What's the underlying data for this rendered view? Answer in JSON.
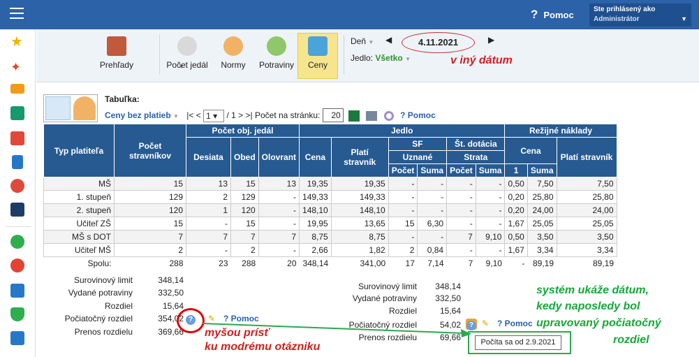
{
  "topbar": {
    "help_label": "Pomoc",
    "user_line1": "Ste prihlásený ako",
    "user_line2": "Administrátor"
  },
  "sidebar": {
    "icons": [
      "star-icon",
      "magic-icon",
      "mail-icon",
      "home-icon",
      "calendar-grid-icon",
      "tablet-icon",
      "person-icon",
      "calendar-icon",
      "check-icon",
      "pdf-icon",
      "briefcase-icon",
      "shield-icon",
      "chart-icon"
    ]
  },
  "toolbar": {
    "prehlady": "Prehľady",
    "pocet_jedal": "Počet jedál",
    "normy": "Normy",
    "potraviny": "Potraviny",
    "ceny": "Ceny",
    "den_label": "Deň",
    "date": "4.11.2021",
    "jedlo_label": "Jedlo:",
    "jedlo_value": "Všetko"
  },
  "annotations": {
    "date_note": "v iný dátum",
    "mouse_note_1": "myšou prísť",
    "mouse_note_2": "ku modrému otázniku",
    "system_note_1": "systém ukáže dátum,",
    "system_note_2": "kedy naposledy bol",
    "system_note_3": "upravovaný počiatočný",
    "system_note_4": "rozdiel"
  },
  "tabulka": {
    "label": "Tabuľka:",
    "selected": "Ceny bez platieb",
    "page_current": "1",
    "page_total": "/ 1",
    "per_page_label": "Počet na stránku:",
    "per_page_value": "20",
    "help": "Pomoc"
  },
  "table": {
    "h_typ": "Typ platiteľa",
    "h_pocet_strav": "Počet stravníkov",
    "h_pocet_obj": "Počet obj. jedál",
    "h_jedlo": "Jedlo",
    "h_rezijne": "Režijné náklady",
    "h_desiata": "Desiata",
    "h_obed": "Obed",
    "h_olovrant": "Olovrant",
    "h_cena": "Cena",
    "h_plati": "Platí stravník",
    "h_sf": "SF",
    "h_st_dotacia": "Št. dotácia",
    "h_uznane": "Uznané",
    "h_strata": "Strata",
    "h_pocet": "Počet",
    "h_suma": "Suma",
    "h_1": "1",
    "rows": [
      [
        "MŠ",
        "15",
        "13",
        "15",
        "13",
        "19,35",
        "19,35",
        "-",
        "-",
        "-",
        "-",
        "0,50",
        "7,50",
        "7,50"
      ],
      [
        "1. stupeň",
        "129",
        "2",
        "129",
        "-",
        "149,33",
        "149,33",
        "-",
        "-",
        "-",
        "-",
        "0,20",
        "25,80",
        "25,80"
      ],
      [
        "2. stupeň",
        "120",
        "1",
        "120",
        "-",
        "148,10",
        "148,10",
        "-",
        "-",
        "-",
        "-",
        "0,20",
        "24,00",
        "24,00"
      ],
      [
        "Učiteľ ZŠ",
        "15",
        "-",
        "15",
        "-",
        "19,95",
        "13,65",
        "15",
        "6,30",
        "-",
        "-",
        "1,67",
        "25,05",
        "25,05"
      ],
      [
        "MŠ s DOT",
        "7",
        "7",
        "7",
        "7",
        "8,75",
        "8,75",
        "-",
        "-",
        "7",
        "9,10",
        "0,50",
        "3,50",
        "3,50"
      ],
      [
        "Učiteľ MŠ",
        "2",
        "-",
        "2",
        "-",
        "2,66",
        "1,82",
        "2",
        "0,84",
        "-",
        "-",
        "1,67",
        "3,34",
        "3,34"
      ]
    ],
    "total": [
      "Spolu:",
      "288",
      "23",
      "288",
      "20",
      "348,14",
      "341,00",
      "17",
      "7,14",
      "7",
      "9,10",
      "-",
      "89,19",
      "89,19"
    ]
  },
  "summary_left": {
    "labels": [
      "Surovinový limit",
      "Vydané potraviny",
      "Rozdiel",
      "Počiatočný rozdiel",
      "Prenos rozdielu"
    ],
    "values": [
      "348,14",
      "332,50",
      "15,64",
      "354,02",
      "369,66"
    ],
    "help": "Pomoc"
  },
  "summary_right": {
    "labels": [
      "Surovinový limit",
      "Vydané potraviny",
      "Rozdiel",
      "Počiatočný rozdiel",
      "Prenos rozdielu"
    ],
    "values": [
      "348,14",
      "332,50",
      "15,64",
      "54,02",
      "69,66"
    ],
    "help": "Pomoc",
    "tooltip": "Počíta sa od 2.9.2021"
  }
}
